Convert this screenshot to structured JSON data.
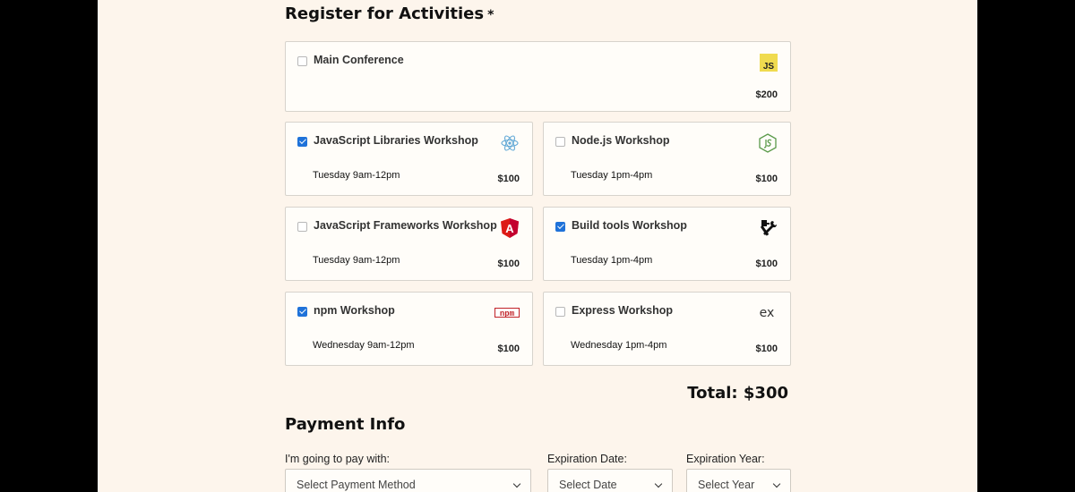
{
  "activities": {
    "title": "Register for Activities",
    "required_mark": "*",
    "main": {
      "name": "Main Conference",
      "price": "$200",
      "checked": false,
      "icon": "javascript-logo-icon",
      "icon_text": "JS"
    },
    "workshops": [
      {
        "name": "JavaScript Libraries Workshop",
        "time": "Tuesday 9am-12pm",
        "price": "$100",
        "checked": true,
        "icon": "react-logo-icon"
      },
      {
        "name": "Node.js Workshop",
        "time": "Tuesday 1pm-4pm",
        "price": "$100",
        "checked": false,
        "icon": "nodejs-logo-icon"
      },
      {
        "name": "JavaScript Frameworks Workshop",
        "time": "Tuesday 9am-12pm",
        "price": "$100",
        "checked": false,
        "icon": "angular-logo-icon",
        "icon_text": "A"
      },
      {
        "name": "Build tools Workshop",
        "time": "Tuesday 1pm-4pm",
        "price": "$100",
        "checked": true,
        "icon": "hammer-wrench-icon"
      },
      {
        "name": "npm Workshop",
        "time": "Wednesday 9am-12pm",
        "price": "$100",
        "checked": true,
        "icon": "npm-logo-icon",
        "icon_text": "npm"
      },
      {
        "name": "Express Workshop",
        "time": "Wednesday 1pm-4pm",
        "price": "$100",
        "checked": false,
        "icon": "express-logo-icon",
        "icon_text": "ex"
      }
    ],
    "total": "Total: $300"
  },
  "payment": {
    "title": "Payment Info",
    "method_label": "I'm going to pay with:",
    "method_value": "Select Payment Method",
    "date_label": "Expiration Date:",
    "date_value": "Select Date",
    "year_label": "Expiration Year:",
    "year_value": "Select Year"
  },
  "colors": {
    "background": "#fdf5ec",
    "checkbox_accent": "#1f72d9"
  }
}
